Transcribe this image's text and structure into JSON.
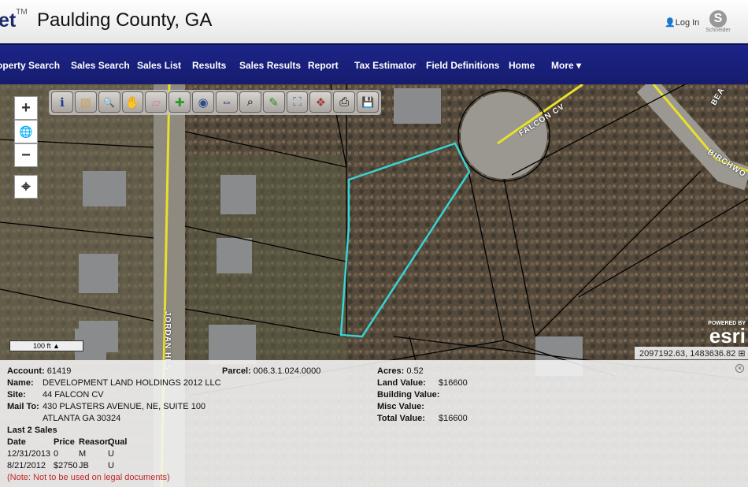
{
  "header": {
    "brand": "et",
    "brand_mark": "TM",
    "title": "Paulding County, GA",
    "login": "Log In",
    "logo_text": "Schneider"
  },
  "nav": {
    "items": [
      "operty Search",
      "Sales Search",
      "Sales List",
      "Results",
      "Sales Results",
      "Report",
      "Tax Estimator",
      "Field Definitions",
      "Home",
      "More ▾"
    ]
  },
  "toolbar": {
    "tools": [
      {
        "icon": "info-icon",
        "glyph": "ℹ"
      },
      {
        "icon": "select-icon",
        "glyph": "▨"
      },
      {
        "icon": "zoom-in-icon",
        "glyph": "🔍"
      },
      {
        "icon": "pan-hand-icon",
        "glyph": "✋"
      },
      {
        "icon": "eraser-icon",
        "glyph": "▱"
      },
      {
        "icon": "add-selection-icon",
        "glyph": "✚"
      },
      {
        "icon": "globe-icon",
        "glyph": "◉"
      },
      {
        "icon": "measure-icon",
        "glyph": "⇔"
      },
      {
        "icon": "zoom-search-icon",
        "glyph": "⌕"
      },
      {
        "icon": "pencil-icon",
        "glyph": "✎"
      },
      {
        "icon": "full-extent-icon",
        "glyph": "⛶"
      },
      {
        "icon": "layers-icon",
        "glyph": "❖"
      },
      {
        "icon": "print-icon",
        "glyph": "⎙"
      },
      {
        "icon": "save-icon",
        "glyph": "💾"
      }
    ]
  },
  "map_controls": {
    "zoom_in": "+",
    "globe": "🌐",
    "zoom_out": "−",
    "locate": "⌖"
  },
  "map": {
    "scale": "100 ft ▲",
    "esri_powered": "POWERED BY",
    "esri": "esri",
    "coords": "2097192.63, 1483636.82 ⊞",
    "labels": {
      "falcon": "FALCON CV",
      "jordan": "JORDAN HLS",
      "birch": "BIRCHWO",
      "bea": "BEA"
    },
    "highlight_color": "#38d4d4",
    "road_color": "#e8e02a"
  },
  "info": {
    "account_label": "Account:",
    "account": "61419",
    "parcel_label": "Parcel:",
    "parcel": "006.3.1.024.0000",
    "acres_label": "Acres:",
    "acres": "0.52",
    "name_label": "Name:",
    "name": "DEVELOPMENT LAND HOLDINGS 2012 LLC",
    "site_label": "Site:",
    "site": "44 FALCON CV",
    "mail_label": "Mail To:",
    "mail1": "430 PLASTERS AVENUE, NE, SUITE 100",
    "mail2": "ATLANTA GA 30324",
    "land_label": "Land Value:",
    "land": "$16600",
    "building_label": "Building Value:",
    "misc_label": "Misc Value:",
    "total_label": "Total Value:",
    "total": "$16600",
    "sales_title": "Last 2 Sales",
    "sales_headers": [
      "Date",
      "Price",
      "Reason",
      "Qual"
    ],
    "sales": [
      {
        "date": "12/31/2013",
        "price": "0",
        "reason": "M",
        "qual": "U"
      },
      {
        "date": "8/21/2012",
        "price": "$2750",
        "reason": "JB",
        "qual": "U"
      }
    ],
    "note": "(Note: Not to be used on legal documents)",
    "close": "×"
  }
}
